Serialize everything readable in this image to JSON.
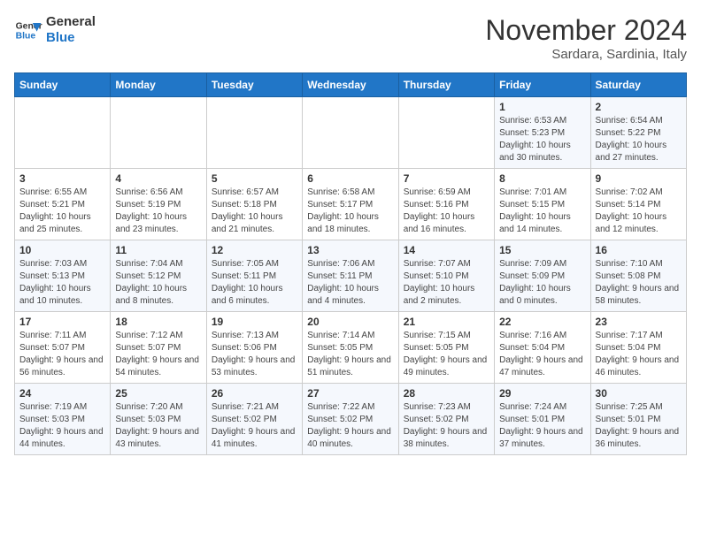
{
  "header": {
    "logo_line1": "General",
    "logo_line2": "Blue",
    "month": "November 2024",
    "location": "Sardara, Sardinia, Italy"
  },
  "weekdays": [
    "Sunday",
    "Monday",
    "Tuesday",
    "Wednesday",
    "Thursday",
    "Friday",
    "Saturday"
  ],
  "weeks": [
    [
      {
        "day": "",
        "info": ""
      },
      {
        "day": "",
        "info": ""
      },
      {
        "day": "",
        "info": ""
      },
      {
        "day": "",
        "info": ""
      },
      {
        "day": "",
        "info": ""
      },
      {
        "day": "1",
        "info": "Sunrise: 6:53 AM\nSunset: 5:23 PM\nDaylight: 10 hours and 30 minutes."
      },
      {
        "day": "2",
        "info": "Sunrise: 6:54 AM\nSunset: 5:22 PM\nDaylight: 10 hours and 27 minutes."
      }
    ],
    [
      {
        "day": "3",
        "info": "Sunrise: 6:55 AM\nSunset: 5:21 PM\nDaylight: 10 hours and 25 minutes."
      },
      {
        "day": "4",
        "info": "Sunrise: 6:56 AM\nSunset: 5:19 PM\nDaylight: 10 hours and 23 minutes."
      },
      {
        "day": "5",
        "info": "Sunrise: 6:57 AM\nSunset: 5:18 PM\nDaylight: 10 hours and 21 minutes."
      },
      {
        "day": "6",
        "info": "Sunrise: 6:58 AM\nSunset: 5:17 PM\nDaylight: 10 hours and 18 minutes."
      },
      {
        "day": "7",
        "info": "Sunrise: 6:59 AM\nSunset: 5:16 PM\nDaylight: 10 hours and 16 minutes."
      },
      {
        "day": "8",
        "info": "Sunrise: 7:01 AM\nSunset: 5:15 PM\nDaylight: 10 hours and 14 minutes."
      },
      {
        "day": "9",
        "info": "Sunrise: 7:02 AM\nSunset: 5:14 PM\nDaylight: 10 hours and 12 minutes."
      }
    ],
    [
      {
        "day": "10",
        "info": "Sunrise: 7:03 AM\nSunset: 5:13 PM\nDaylight: 10 hours and 10 minutes."
      },
      {
        "day": "11",
        "info": "Sunrise: 7:04 AM\nSunset: 5:12 PM\nDaylight: 10 hours and 8 minutes."
      },
      {
        "day": "12",
        "info": "Sunrise: 7:05 AM\nSunset: 5:11 PM\nDaylight: 10 hours and 6 minutes."
      },
      {
        "day": "13",
        "info": "Sunrise: 7:06 AM\nSunset: 5:11 PM\nDaylight: 10 hours and 4 minutes."
      },
      {
        "day": "14",
        "info": "Sunrise: 7:07 AM\nSunset: 5:10 PM\nDaylight: 10 hours and 2 minutes."
      },
      {
        "day": "15",
        "info": "Sunrise: 7:09 AM\nSunset: 5:09 PM\nDaylight: 10 hours and 0 minutes."
      },
      {
        "day": "16",
        "info": "Sunrise: 7:10 AM\nSunset: 5:08 PM\nDaylight: 9 hours and 58 minutes."
      }
    ],
    [
      {
        "day": "17",
        "info": "Sunrise: 7:11 AM\nSunset: 5:07 PM\nDaylight: 9 hours and 56 minutes."
      },
      {
        "day": "18",
        "info": "Sunrise: 7:12 AM\nSunset: 5:07 PM\nDaylight: 9 hours and 54 minutes."
      },
      {
        "day": "19",
        "info": "Sunrise: 7:13 AM\nSunset: 5:06 PM\nDaylight: 9 hours and 53 minutes."
      },
      {
        "day": "20",
        "info": "Sunrise: 7:14 AM\nSunset: 5:05 PM\nDaylight: 9 hours and 51 minutes."
      },
      {
        "day": "21",
        "info": "Sunrise: 7:15 AM\nSunset: 5:05 PM\nDaylight: 9 hours and 49 minutes."
      },
      {
        "day": "22",
        "info": "Sunrise: 7:16 AM\nSunset: 5:04 PM\nDaylight: 9 hours and 47 minutes."
      },
      {
        "day": "23",
        "info": "Sunrise: 7:17 AM\nSunset: 5:04 PM\nDaylight: 9 hours and 46 minutes."
      }
    ],
    [
      {
        "day": "24",
        "info": "Sunrise: 7:19 AM\nSunset: 5:03 PM\nDaylight: 9 hours and 44 minutes."
      },
      {
        "day": "25",
        "info": "Sunrise: 7:20 AM\nSunset: 5:03 PM\nDaylight: 9 hours and 43 minutes."
      },
      {
        "day": "26",
        "info": "Sunrise: 7:21 AM\nSunset: 5:02 PM\nDaylight: 9 hours and 41 minutes."
      },
      {
        "day": "27",
        "info": "Sunrise: 7:22 AM\nSunset: 5:02 PM\nDaylight: 9 hours and 40 minutes."
      },
      {
        "day": "28",
        "info": "Sunrise: 7:23 AM\nSunset: 5:02 PM\nDaylight: 9 hours and 38 minutes."
      },
      {
        "day": "29",
        "info": "Sunrise: 7:24 AM\nSunset: 5:01 PM\nDaylight: 9 hours and 37 minutes."
      },
      {
        "day": "30",
        "info": "Sunrise: 7:25 AM\nSunset: 5:01 PM\nDaylight: 9 hours and 36 minutes."
      }
    ]
  ]
}
